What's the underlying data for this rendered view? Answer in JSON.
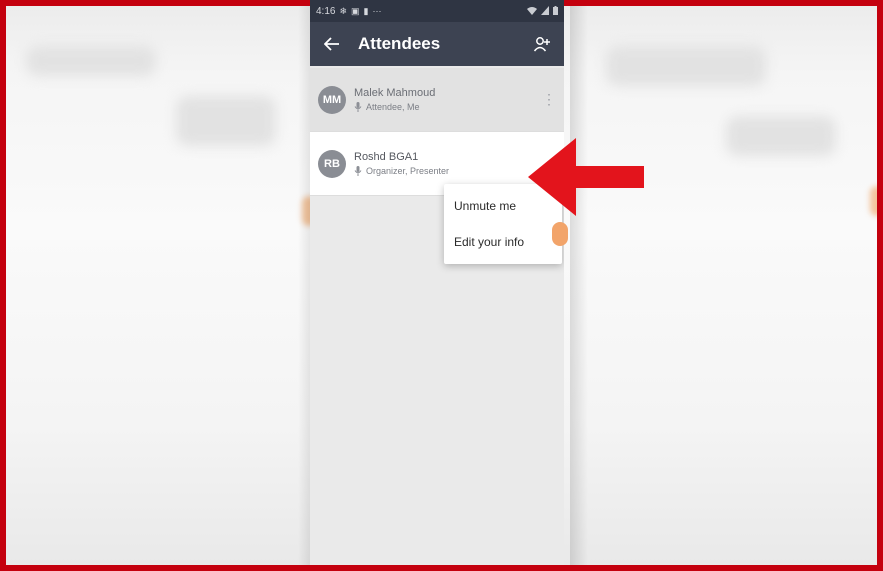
{
  "status_bar": {
    "time": "4:16",
    "left_icons": [
      "snowflake-icon",
      "monitor-icon",
      "camera-icon",
      "more-dots-icon"
    ],
    "right_icons": [
      "wifi-icon",
      "signal-icon",
      "battery-icon"
    ],
    "more_text": "···"
  },
  "appbar": {
    "title": "Attendees"
  },
  "attendees": [
    {
      "initials": "MM",
      "name": "Malek Mahmoud",
      "role": "Attendee, Me"
    },
    {
      "initials": "RB",
      "name": "Roshd BGA1",
      "role": "Organizer, Presenter"
    }
  ],
  "menu": {
    "items": [
      "Unmute me",
      "Edit your info"
    ]
  },
  "colors": {
    "frame_border": "#c4000e",
    "appbar": "#3d4352",
    "arrow": "#e3141c"
  }
}
